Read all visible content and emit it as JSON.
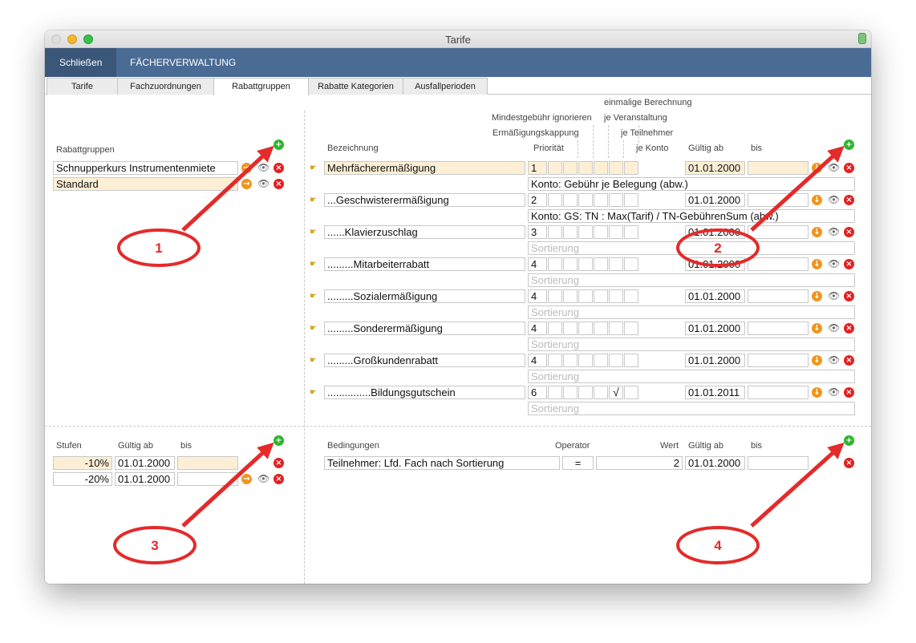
{
  "window": {
    "title": "Tarife"
  },
  "toolbar": {
    "close_label": "Schließen",
    "fach_label": "FÄCHERVERWALTUNG"
  },
  "tabs": [
    {
      "label": "Tarife"
    },
    {
      "label": "Fachzuordnungen"
    },
    {
      "label": "Rabattgruppen"
    },
    {
      "label": "Rabatte Kategorien"
    },
    {
      "label": "Ausfallperioden"
    }
  ],
  "rabattgruppen": {
    "header": "Rabattgruppen",
    "items": [
      {
        "name": "Schnupperkurs Instrumentenmiete"
      },
      {
        "name": "Standard"
      }
    ]
  },
  "rabatte": {
    "headers": {
      "bezeichnung": "Bezeichnung",
      "prioritaet": "Priorität",
      "ermaessigungskappung": "Ermäßigungskappung",
      "mindestgebuehr": "Mindestgebühr ignorieren",
      "einmalige": "einmalige Berechnung",
      "je_veranstaltung": "je Veranstaltung",
      "je_teilnehmer": "je Teilnehmer",
      "je_konto": "je Konto",
      "gueltig_ab": "Gültig ab",
      "bis": "bis"
    },
    "rows": [
      {
        "name": "Mehrfächerermäßigung",
        "prio": "1",
        "check": "",
        "from": "01.01.2000",
        "to": "",
        "sub": "Konto: Gebühr je Belegung (abw.)"
      },
      {
        "name": "...Geschwisterermäßigung",
        "prio": "2",
        "check": "",
        "from": "01.01.2000",
        "to": "",
        "sub": "Konto: GS: TN : Max(Tarif) / TN-GebührenSum (abw.)"
      },
      {
        "name": "......Klavierzuschlag",
        "prio": "3",
        "check": "",
        "from": "01.01.2000",
        "to": "",
        "sub": "Sortierung"
      },
      {
        "name": ".........Mitarbeiterrabatt",
        "prio": "4",
        "check": "",
        "from": "01.01.2000",
        "to": "",
        "sub": "Sortierung"
      },
      {
        "name": ".........Sozialermäßigung",
        "prio": "4",
        "check": "",
        "from": "01.01.2000",
        "to": "",
        "sub": "Sortierung"
      },
      {
        "name": ".........Sonderermäßigung",
        "prio": "4",
        "check": "",
        "from": "01.01.2000",
        "to": "",
        "sub": "Sortierung"
      },
      {
        "name": ".........Großkundenrabatt",
        "prio": "4",
        "check": "",
        "from": "01.01.2000",
        "to": "",
        "sub": "Sortierung"
      },
      {
        "name": "...............Bildungsgutschein",
        "prio": "6",
        "check": "√",
        "from": "01.01.2011",
        "to": "",
        "sub": "Sortierung"
      }
    ]
  },
  "stufen": {
    "headers": {
      "stufen": "Stufen",
      "gueltig_ab": "Gültig ab",
      "bis": "bis"
    },
    "rows": [
      {
        "value": "-10%",
        "from": "01.01.2000",
        "to": ""
      },
      {
        "value": "-20%",
        "from": "01.01.2000",
        "to": ""
      }
    ]
  },
  "bedingungen": {
    "headers": {
      "bedingungen": "Bedingungen",
      "operator": "Operator",
      "wert": "Wert",
      "gueltig_ab": "Gültig ab",
      "bis": "bis"
    },
    "rows": [
      {
        "name": "Teilnehmer: Lfd. Fach nach Sortierung",
        "operator": "=",
        "wert": "2",
        "from": "01.01.2000",
        "to": ""
      }
    ]
  },
  "annotations": [
    "1",
    "2",
    "3",
    "4"
  ],
  "icons": {
    "add": "plus-circle-icon",
    "delete": "x-circle-icon",
    "goto": "arrow-circle-icon",
    "view": "eye-icon",
    "handle": "hand-icon"
  },
  "colors": {
    "toolbar": "#4a6b94",
    "selected_row": "#fdefd6",
    "annotation": "#e42a2a",
    "add": "#2db52d",
    "delete": "#e32020"
  }
}
